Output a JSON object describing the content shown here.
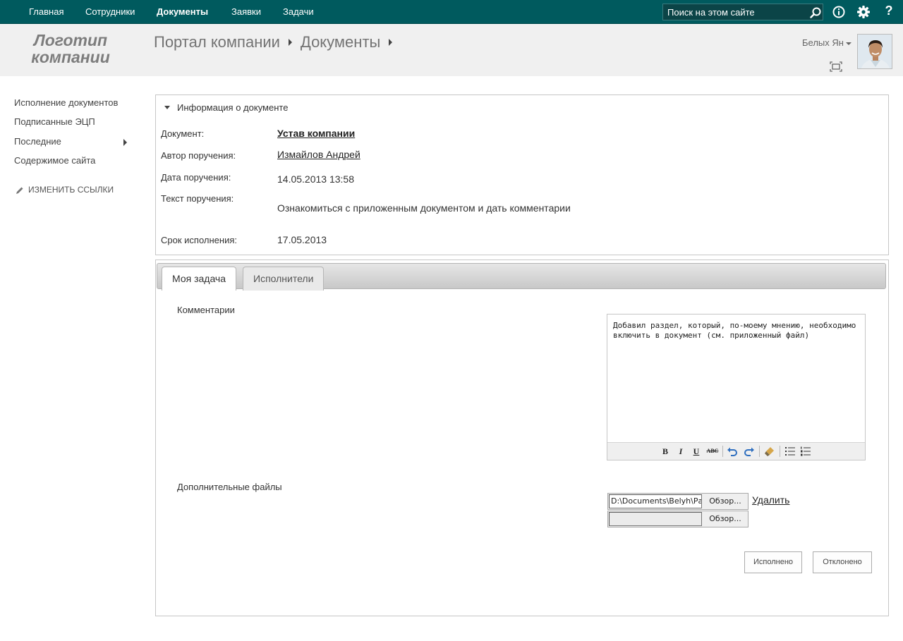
{
  "topnav": {
    "items": [
      "Главная",
      "Сотрудники",
      "Документы",
      "Заявки",
      "Задачи"
    ],
    "active_index": 2,
    "search_placeholder": "Поиск на этом сайте",
    "icons": [
      "search-icon",
      "info-icon",
      "gear-icon",
      "help-icon"
    ],
    "help_label": "?"
  },
  "header": {
    "logo_line1": "Логотип",
    "logo_line2": "компании",
    "breadcrumb": [
      "Портал компании",
      "Документы"
    ],
    "user_name": "Белых Ян"
  },
  "leftnav": {
    "items": [
      "Исполнение документов",
      "Подписанные ЭЦП",
      "Последние",
      "Содержимое сайта"
    ],
    "edit_links": "ИЗМЕНИТЬ ССЫЛКИ"
  },
  "info": {
    "title": "Информация о документе",
    "fields": [
      {
        "label": "Документ:",
        "value": "Устав компании"
      },
      {
        "label": "Автор поручения:",
        "value": "Измайлов Андрей"
      },
      {
        "label": "Дата поручения:",
        "value": "14.05.2013 13:58"
      },
      {
        "label": "Текст поручения:",
        "value": "Ознакомиться с приложенным документом и дать комментарии"
      },
      {
        "label": "Срок исполнения:",
        "value": "17.05.2013"
      }
    ]
  },
  "task": {
    "tabs": [
      "Моя задача",
      "Исполнители"
    ],
    "active_tab": 0,
    "comments_label": "Комментарии",
    "comment_text": "Добавил раздел, который, по-моему мнению, необходимо включить в документ (см. приложенный файл)",
    "toolbar": {
      "bold": "B",
      "italic": "I",
      "underline": "U",
      "strike": "ABC"
    },
    "files_label": "Дополнительные файлы",
    "files": [
      {
        "path": "D:\\Documents\\Belyh\\Рабо",
        "browse": "Обзор..."
      },
      {
        "path": "",
        "browse": "Обзор..."
      }
    ],
    "delete_label": "Удалить",
    "done_button": "Исполнено",
    "reject_button": "Отклонено"
  },
  "colors": {
    "topnav_bg": "#005a5e",
    "header_bg": "#f0f0f0",
    "text": "#333333"
  }
}
